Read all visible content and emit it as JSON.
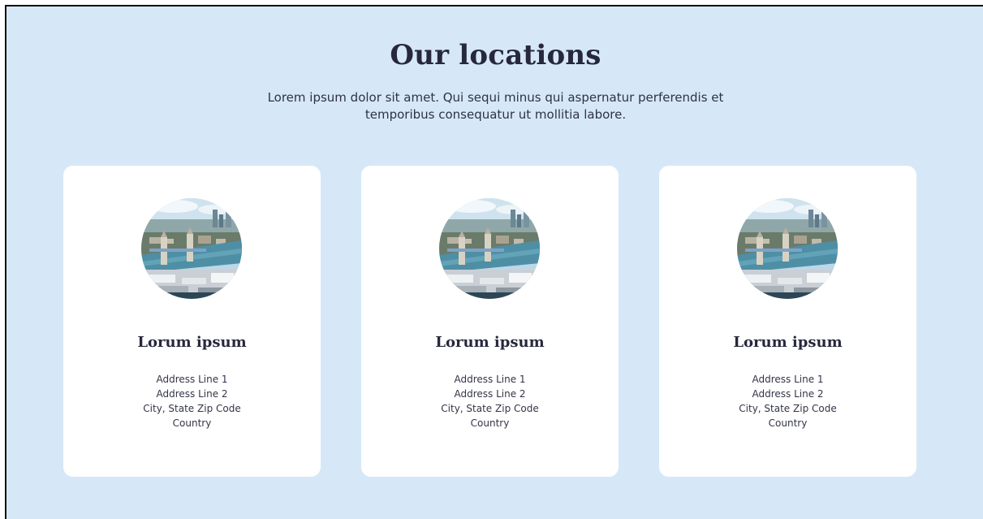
{
  "section": {
    "title": "Our locations",
    "subtitle": "Lorem ipsum dolor sit amet. Qui sequi minus qui aspernatur perferendis et temporibus consequatur ut mollitia labore."
  },
  "cards": [
    {
      "name": "Lorum ipsum",
      "address_line_1": "Address Line 1",
      "address_line_2": "Address Line 2",
      "city_state_zip": "City, State Zip Code",
      "country": "Country",
      "image_icon": "city-bridge-photo"
    },
    {
      "name": "Lorum ipsum",
      "address_line_1": "Address Line 1",
      "address_line_2": "Address Line 2",
      "city_state_zip": "City, State Zip Code",
      "country": "Country",
      "image_icon": "city-bridge-photo"
    },
    {
      "name": "Lorum ipsum",
      "address_line_1": "Address Line 1",
      "address_line_2": "Address Line 2",
      "city_state_zip": "City, State Zip Code",
      "country": "Country",
      "image_icon": "city-bridge-photo"
    }
  ],
  "colors": {
    "background": "#d6e8f8",
    "card": "#ffffff",
    "heading": "#27283d",
    "text": "#2f3148"
  }
}
